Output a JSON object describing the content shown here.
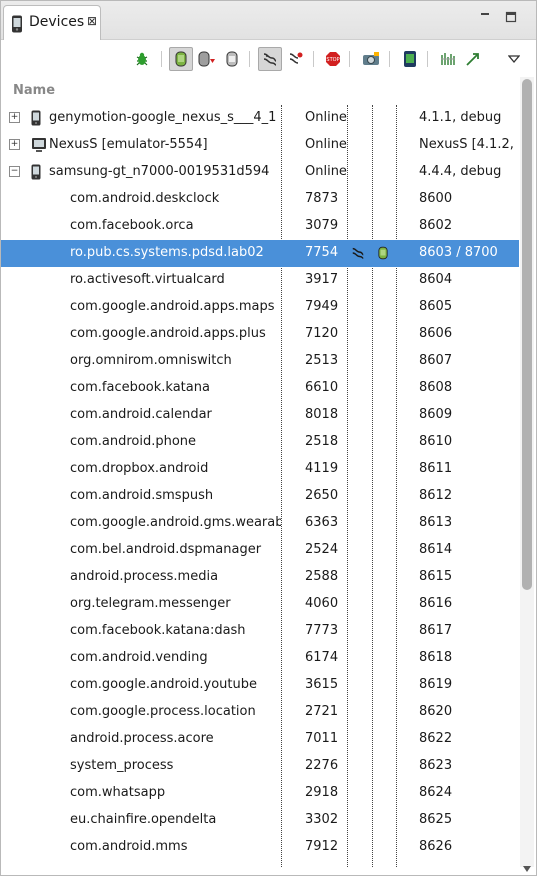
{
  "tab": {
    "label": "Devices",
    "close": "⊠"
  },
  "window_buttons": {
    "minimize": "—",
    "maximize": "▢"
  },
  "toolbar": {
    "icons": [
      "debug-bug-icon",
      "update-heap-icon",
      "dump-hprof-icon",
      "cause-gc-icon",
      "update-threads-icon",
      "start-method-profiling-icon",
      "stop-process-icon",
      "screen-capture-icon",
      "dump-view-hierarchy-icon",
      "systrace-icon",
      "opengl-trace-icon",
      "view-menu-icon"
    ]
  },
  "header": {
    "name": "Name"
  },
  "devices": [
    {
      "name": "genymotion-google_nexus_s___4_1",
      "status": "Online",
      "info": "4.1.1, debug",
      "icon": "phone-icon",
      "expander": "+"
    },
    {
      "name": "NexusS [emulator-5554]",
      "status": "Online",
      "info": "NexusS [4.1.2,",
      "icon": "emulator-icon",
      "expander": "+"
    },
    {
      "name": "samsung-gt_n7000-0019531d594",
      "status": "Online",
      "info": "4.4.4, debug",
      "icon": "phone-icon",
      "expander": "−"
    }
  ],
  "processes": [
    {
      "name": "com.android.deskclock",
      "pid": "7873",
      "port": "8600"
    },
    {
      "name": "com.facebook.orca",
      "pid": "3079",
      "port": "8602"
    },
    {
      "name": "ro.pub.cs.systems.pdsd.lab02",
      "pid": "7754",
      "port": "8603 / 8700",
      "selected": true
    },
    {
      "name": "ro.activesoft.virtualcard",
      "pid": "3917",
      "port": "8604"
    },
    {
      "name": "com.google.android.apps.maps",
      "pid": "7949",
      "port": "8605"
    },
    {
      "name": "com.google.android.apps.plus",
      "pid": "7120",
      "port": "8606"
    },
    {
      "name": "org.omnirom.omniswitch",
      "pid": "2513",
      "port": "8607"
    },
    {
      "name": "com.facebook.katana",
      "pid": "6610",
      "port": "8608"
    },
    {
      "name": "com.android.calendar",
      "pid": "8018",
      "port": "8609"
    },
    {
      "name": "com.android.phone",
      "pid": "2518",
      "port": "8610"
    },
    {
      "name": "com.dropbox.android",
      "pid": "4119",
      "port": "8611"
    },
    {
      "name": "com.android.smspush",
      "pid": "2650",
      "port": "8612"
    },
    {
      "name": "com.google.android.gms.wearabl",
      "pid": "6363",
      "port": "8613"
    },
    {
      "name": "com.bel.android.dspmanager",
      "pid": "2524",
      "port": "8614"
    },
    {
      "name": "android.process.media",
      "pid": "2588",
      "port": "8615"
    },
    {
      "name": "org.telegram.messenger",
      "pid": "4060",
      "port": "8616"
    },
    {
      "name": "com.facebook.katana:dash",
      "pid": "7773",
      "port": "8617"
    },
    {
      "name": "com.android.vending",
      "pid": "6174",
      "port": "8618"
    },
    {
      "name": "com.google.android.youtube",
      "pid": "3615",
      "port": "8619"
    },
    {
      "name": "com.google.process.location",
      "pid": "2721",
      "port": "8620"
    },
    {
      "name": "android.process.acore",
      "pid": "7011",
      "port": "8622"
    },
    {
      "name": "system_process",
      "pid": "2276",
      "port": "8623"
    },
    {
      "name": "com.whatsapp",
      "pid": "2918",
      "port": "8624"
    },
    {
      "name": "eu.chainfire.opendelta",
      "pid": "3302",
      "port": "8625"
    },
    {
      "name": "com.android.mms",
      "pid": "7912",
      "port": "8626"
    }
  ],
  "colors": {
    "selection": "#4a90d9",
    "bug_green": "#2e9e2e",
    "stop_red": "#d22020"
  }
}
